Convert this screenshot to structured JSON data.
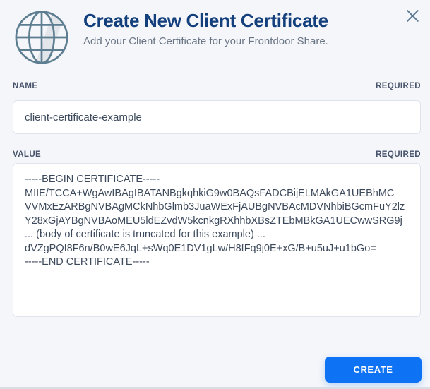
{
  "modal": {
    "title": "Create New Client Certificate",
    "subtitle": "Add your Client Certificate for your Frontdoor Share.",
    "icons": {
      "header": "globe-icon",
      "close": "close-x-icon"
    }
  },
  "fields": {
    "name": {
      "label": "NAME",
      "required_badge": "REQUIRED",
      "value": "client-certificate-example"
    },
    "value": {
      "label": "VALUE",
      "required_badge": "REQUIRED",
      "value": "-----BEGIN CERTIFICATE-----\nMIIE/TCCA+WgAwIBAgIBATANBgkqhkiG9w0BAQsFADCBijELMAkGA1UEBhMC\nVVMxEzARBgNVBAgMCkNhbGlmb3JuaWExFjAUBgNVBAcMDVNhbiBGcmFuY2lz\nY28xGjAYBgNVBAoMEU5ldEZvdW5kcnkgRXhhbXBsZTEbMBkGA1UECwwSRG9j\n... (body of certificate is truncated for this example) ...\ndVZgPQI8F6n/B0wE6JqL+sWq0E1DV1gLw/H8fFq9j0E+xG/B+u5uJ+u1bGo=\n-----END CERTIFICATE-----"
    }
  },
  "footer": {
    "create_label": "CREATE"
  },
  "colors": {
    "accent_blue": "#0e72f5",
    "title_navy": "#133f7c",
    "icon_stroke": "#5d7d91",
    "background": "#f4f6fa",
    "input_border": "#dfe3ee",
    "label_text": "#47536b"
  }
}
